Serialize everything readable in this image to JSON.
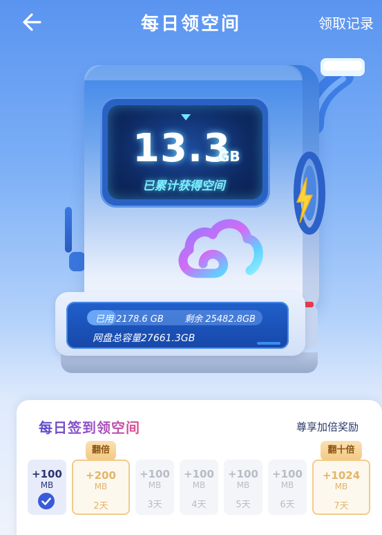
{
  "header": {
    "title": "每日领空间",
    "records_label": "领取记录"
  },
  "machine": {
    "accumulated_value": "13.3",
    "accumulated_unit": "GB",
    "accumulated_label": "已累计获得空间",
    "used_label": "已用",
    "used_value": "2178.6 GB",
    "remaining_label": "剩余",
    "remaining_value": "25482.8GB",
    "total_text": "网盘总容量27661.3GB"
  },
  "checkin": {
    "title": "每日签到领空间",
    "bonus_link": "尊享加倍奖励",
    "days": [
      {
        "amount": "+100",
        "unit": "MB",
        "label": "",
        "state": "done"
      },
      {
        "amount": "+200",
        "unit": "MB",
        "label": "2天",
        "state": "special",
        "badge": "翻倍"
      },
      {
        "amount": "+100",
        "unit": "MB",
        "label": "3天",
        "state": "pending"
      },
      {
        "amount": "+100",
        "unit": "MB",
        "label": "4天",
        "state": "pending"
      },
      {
        "amount": "+100",
        "unit": "MB",
        "label": "5天",
        "state": "pending"
      },
      {
        "amount": "+100",
        "unit": "MB",
        "label": "6天",
        "state": "pending"
      },
      {
        "amount": "+1024",
        "unit": "MB",
        "label": "7天",
        "state": "special",
        "badge": "翻十倍"
      }
    ]
  },
  "colors": {
    "accent": "#3a5ad8",
    "special_gold": "#e2b46a",
    "screen_glow": "#7cf0ff"
  }
}
